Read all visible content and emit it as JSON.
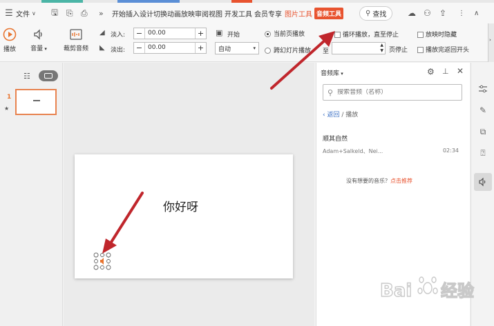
{
  "menubar": {
    "file_label": "文件",
    "tabs": [
      "开始",
      "插入",
      "设计",
      "切换",
      "动画",
      "放映",
      "审阅",
      "视图",
      "开发工具",
      "会员专享"
    ],
    "picture_tools": "图片工具",
    "audio_tools": "音频工具",
    "search_label": "查找"
  },
  "toolbar": {
    "play_label": "播放",
    "volume_label": "音量",
    "trim_label": "裁剪音频",
    "fade_in_label": "淡入:",
    "fade_in_value": "00.00",
    "fade_out_label": "淡出:",
    "fade_out_value": "00.00",
    "start_label": "开始",
    "start_value": "自动",
    "current_page_play": "当前页播放",
    "cross_slide_play": "跨幻灯片播放",
    "to_label": "至",
    "page_stop": "页停止",
    "loop_play": "循环播放，直至停止",
    "hide_when_playing": "放映时隐藏",
    "rewind_after_play": "播放完返回开头"
  },
  "leftpanel": {
    "slide_number": "1"
  },
  "slide": {
    "text": "你好呀"
  },
  "rightpanel": {
    "title": "音频库",
    "search_placeholder": "搜索音频（名称）",
    "back_label": "返回",
    "breadcrumb_sep": "/",
    "breadcrumb_current": "播放",
    "track_title": "顺其自然",
    "track_artist": "Adam+Salkeld、Nei...",
    "track_duration": "02:34",
    "no_music_text": "没有想要的音乐？",
    "recommend_link": "点击推荐"
  },
  "colors": {
    "accent": "#e8532f",
    "arrow": "#c0262c"
  }
}
